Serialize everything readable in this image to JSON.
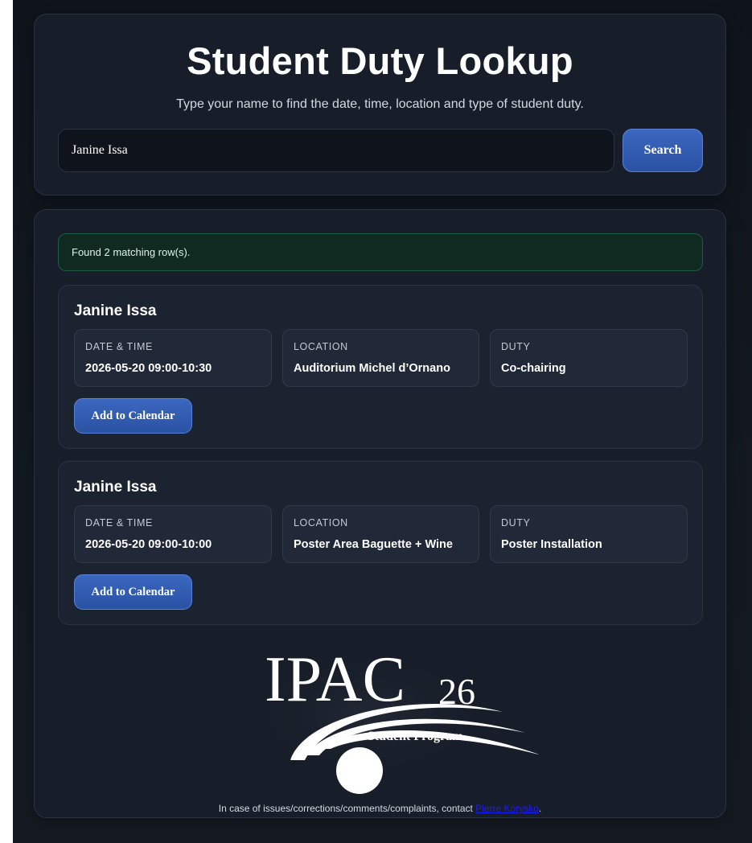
{
  "header": {
    "title": "Student Duty Lookup",
    "subtitle": "Type your name to find the date, time, location and type of student duty."
  },
  "search": {
    "value": "Janine Issa",
    "placeholder": "",
    "button_label": "Search"
  },
  "results": {
    "status": "Found 2 matching row(s).",
    "cards": [
      {
        "name": "Janine Issa",
        "fields": [
          {
            "label": "DATE & TIME",
            "value": "2026-05-20 09:00-10:30"
          },
          {
            "label": "LOCATION",
            "value": "Auditorium Michel d’Ornano"
          },
          {
            "label": "DUTY",
            "value": "Co-chairing"
          }
        ],
        "button_label": "Add to Calendar"
      },
      {
        "name": "Janine Issa",
        "fields": [
          {
            "label": "DATE & TIME",
            "value": "2026-05-20 09:00-10:00"
          },
          {
            "label": "LOCATION",
            "value": "Poster Area Baguette + Wine"
          },
          {
            "label": "DUTY",
            "value": "Poster Installation"
          }
        ],
        "button_label": "Add to Calendar"
      }
    ]
  },
  "logo": {
    "main": "IPAC",
    "year": "26",
    "program": "Student Program"
  },
  "footer": {
    "text": "In case of issues/corrections/comments/complaints, contact ",
    "contact_name": "Pierre Korysko",
    "end": "."
  },
  "colors": {
    "accent": "#2f5bb3",
    "status_bg": "#102a22",
    "background": "#141921"
  }
}
